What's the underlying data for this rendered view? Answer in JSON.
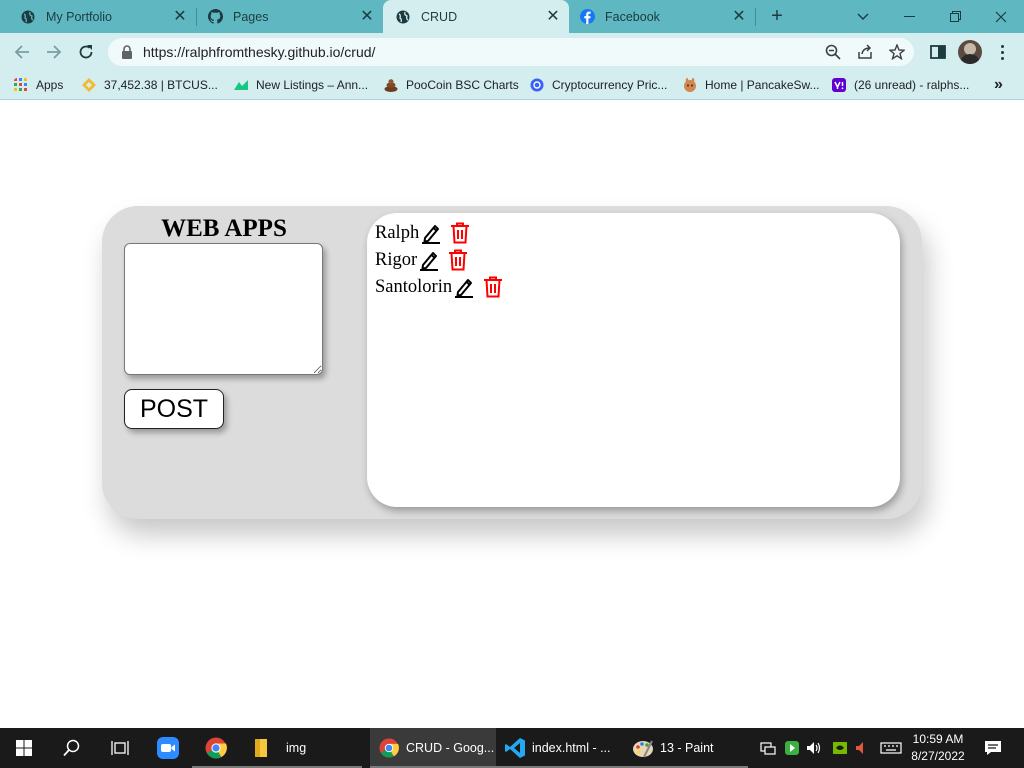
{
  "browser": {
    "tabs": [
      {
        "label": "My Portfolio",
        "icon": "globe-icon"
      },
      {
        "label": "Pages",
        "icon": "github-icon"
      },
      {
        "label": "CRUD",
        "icon": "globe-icon",
        "active": true
      },
      {
        "label": "Facebook",
        "icon": "facebook-icon"
      }
    ],
    "url": "https://ralphfromthesky.github.io/crud/",
    "bookmarks": [
      {
        "label": "Apps"
      },
      {
        "label": "37,452.38 | BTCUS..."
      },
      {
        "label": "New Listings – Ann..."
      },
      {
        "label": "PooCoin BSC Charts"
      },
      {
        "label": "Cryptocurrency Pric..."
      },
      {
        "label": "Home | PancakeSw..."
      },
      {
        "label": "(26 unread) - ralphs..."
      }
    ],
    "more_bookmarks": "»"
  },
  "app": {
    "title": "WEB APPS",
    "input_value": "",
    "post_button": "POST",
    "posts": [
      {
        "text": "Ralph"
      },
      {
        "text": "Rigor"
      },
      {
        "text": "Santolorin"
      }
    ],
    "colors": {
      "delete": "#ff0000",
      "panel": "#dcdcdc"
    }
  },
  "taskbar": {
    "items": [
      {
        "label": "img"
      },
      {
        "label": "CRUD - Goog..."
      },
      {
        "label": "index.html - ..."
      },
      {
        "label": "13 - Paint"
      }
    ],
    "time": "10:59 AM",
    "date": "8/27/2022"
  }
}
